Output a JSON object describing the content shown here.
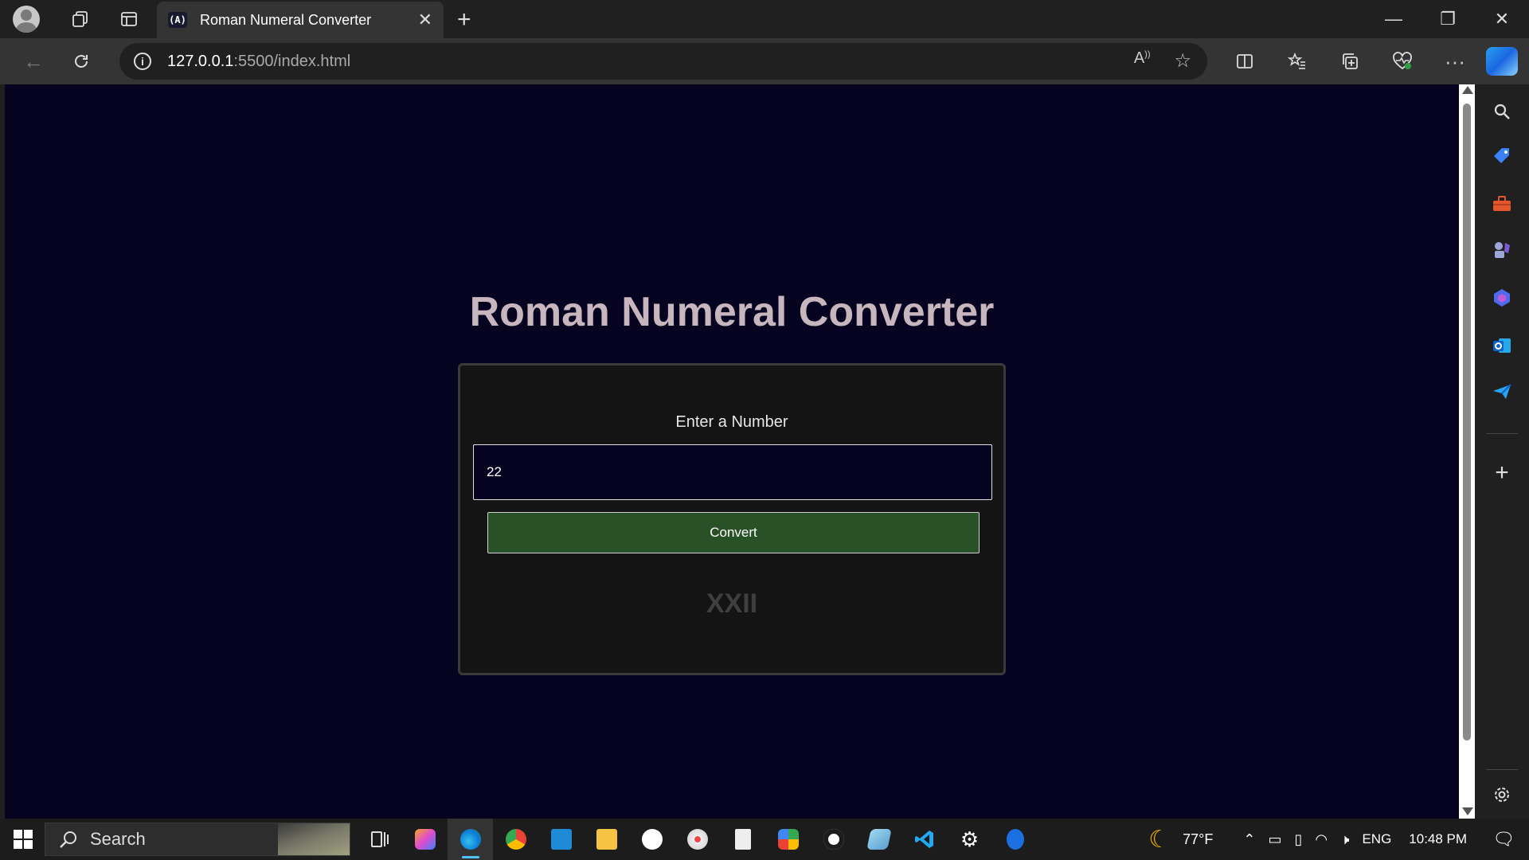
{
  "browser": {
    "tab_title": "Roman Numeral Converter",
    "tab_favicon": "(A)",
    "url_host": "127.0.0.1",
    "url_rest": ":5500/index.html"
  },
  "page": {
    "title": "Roman Numeral Converter",
    "input_label": "Enter a Number",
    "input_value": "22",
    "button_label": "Convert",
    "result": "XXII"
  },
  "taskbar": {
    "search_label": "Search",
    "weather": "77°F",
    "language": "ENG",
    "time": "10:48 PM"
  },
  "colors": {
    "page_background": "#060320",
    "title": "#c7b6bd",
    "card": "#141414",
    "button": "#285128",
    "result": "#3f3f3f"
  }
}
